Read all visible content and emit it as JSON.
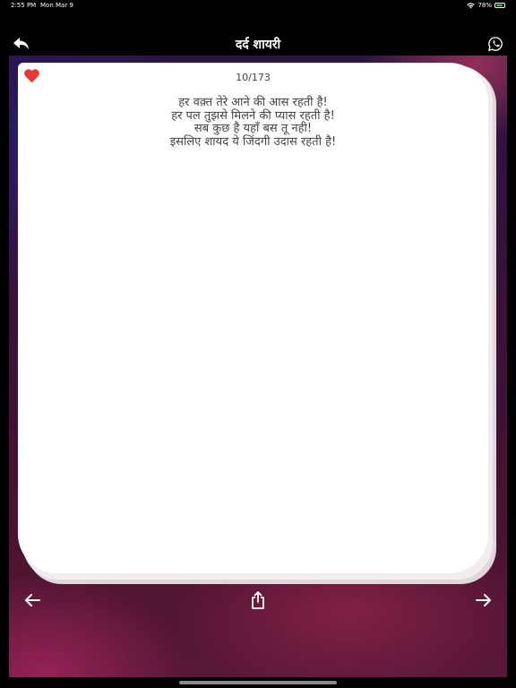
{
  "status_bar": {
    "time": "2:55 PM",
    "date": "Mon Mar 9",
    "battery_percent": "78%"
  },
  "nav": {
    "title": "दर्द शायरी",
    "back_icon": "back-arrow-icon",
    "share_icon": "whatsapp-icon"
  },
  "card": {
    "counter": "10/173",
    "favorite_icon": "heart-icon",
    "favorite_color": "#e53935",
    "lines": [
      "हर वक़्त तेरे आने की आस रहती है!",
      "हर पल तुझसे मिलने की प्यास रहती है!",
      "सब कुछ है यहाँ बस तू नही!",
      "इसलिए शायद ये जिंदगी उदास रहती है!"
    ]
  },
  "bottom_bar": {
    "prev_icon": "left-arrow-icon",
    "share_icon": "share-icon",
    "next_icon": "right-arrow-icon"
  }
}
